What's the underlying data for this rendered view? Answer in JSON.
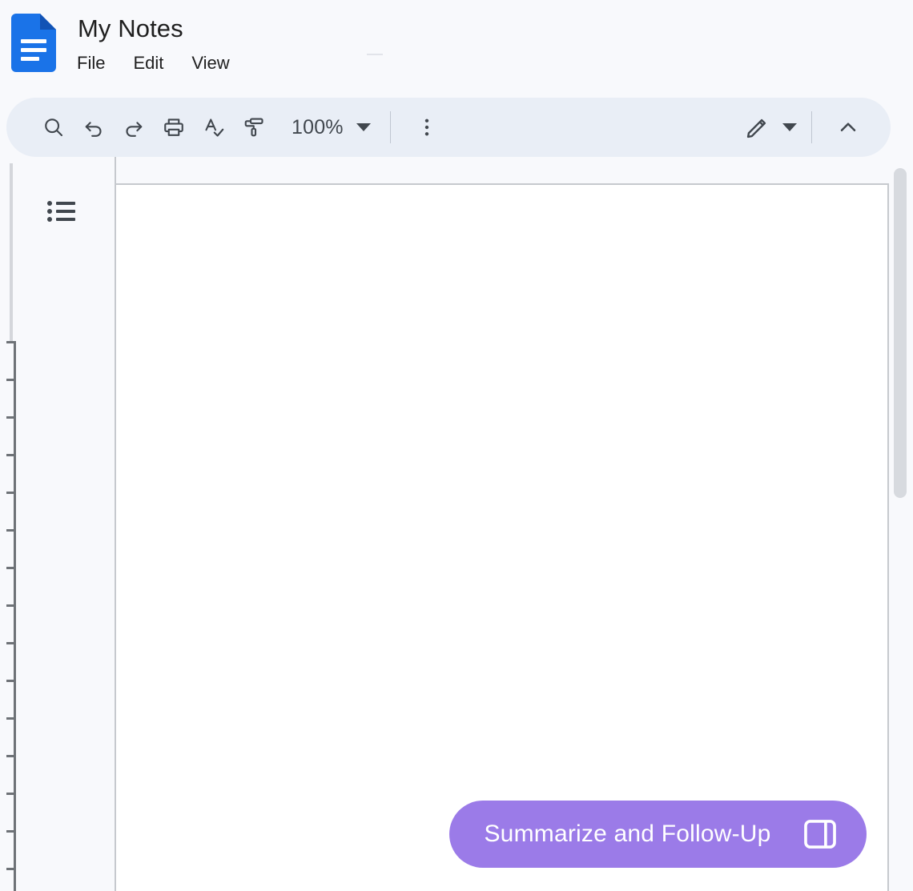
{
  "header": {
    "logo_icon": "google-docs-icon",
    "doc_title": "My Notes",
    "menu_items": [
      {
        "label": "File",
        "name": "file"
      },
      {
        "label": "Edit",
        "name": "edit"
      },
      {
        "label": "View",
        "name": "view"
      }
    ]
  },
  "toolbar": {
    "background_color": "#E9EEF6",
    "buttons": [
      {
        "name": "search-icon",
        "tooltip": "Search"
      },
      {
        "name": "undo-icon",
        "tooltip": "Undo"
      },
      {
        "name": "redo-icon",
        "tooltip": "Redo"
      },
      {
        "name": "print-icon",
        "tooltip": "Print"
      },
      {
        "name": "spellcheck-icon",
        "tooltip": "Spelling and grammar check"
      },
      {
        "name": "paint-format-icon",
        "tooltip": "Paint format"
      }
    ],
    "zoom": {
      "value": "100%",
      "caret_icon": "chevron-down-icon"
    },
    "more_options_icon": "more-vertical-icon",
    "editing_mode": {
      "icon": "pencil-icon",
      "caret_icon": "chevron-down-icon"
    },
    "collapse_icon": "chevron-up-icon"
  },
  "canvas": {
    "outline_icon": "document-outline-icon",
    "page_background": "#FFFFFF",
    "page_text": "",
    "scrollbar": {
      "name": "vertical-scrollbar",
      "thumb_color": "#D7DADF"
    },
    "ruler": {
      "name": "vertical-ruler"
    }
  },
  "cta": {
    "label": "Summarize and Follow-Up",
    "panel_icon": "side-panel-icon",
    "color": "#9B7BE8",
    "text_color": "#FFFFFF"
  }
}
